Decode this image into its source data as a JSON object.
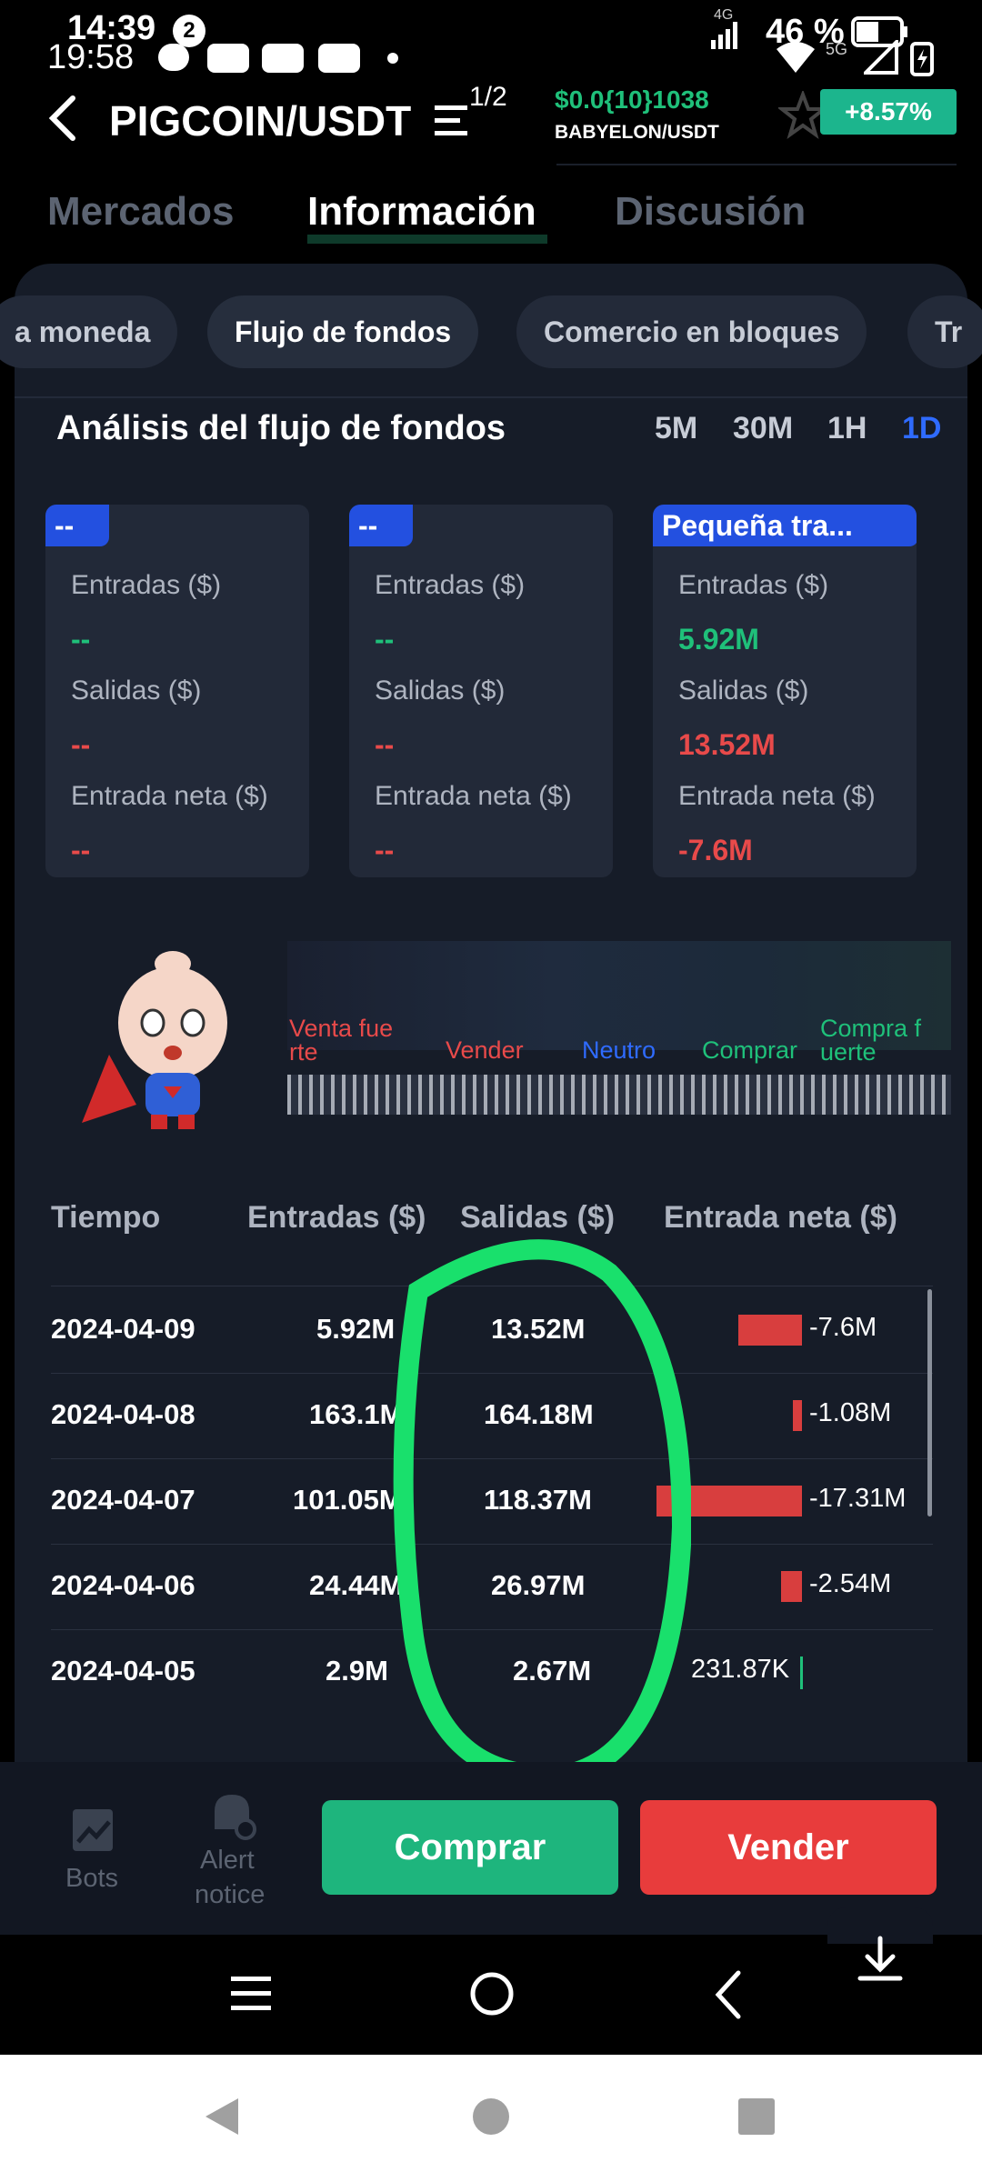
{
  "status": {
    "time_top": "14:39",
    "notif_count": "2",
    "time_bottom": "19:58",
    "battery": "46 %",
    "net_small": "4G",
    "net_5g": "5G",
    "page_indicator": "1/2"
  },
  "header": {
    "pair": "PIGCOIN/USDT",
    "ticker_price": "$0.0{10}1038",
    "ticker_pair": "BABYELON/USDT",
    "change": "+8.57%"
  },
  "tabs": [
    "Mercados",
    "Información",
    "Discusión"
  ],
  "chips": [
    "a moneda",
    "Flujo de fondos",
    "Comercio en bloques",
    "Tr"
  ],
  "analysis": {
    "title": "Análisis del flujo de fondos",
    "periods": [
      "5M",
      "30M",
      "1H",
      "1D"
    ]
  },
  "cards": [
    {
      "tag": "--",
      "in_label": "Entradas ($)",
      "in": "--",
      "out_label": "Salidas ($)",
      "out": "--",
      "net_label": "Entrada neta ($)",
      "net": "--"
    },
    {
      "tag": "--",
      "in_label": "Entradas ($)",
      "in": "--",
      "out_label": "Salidas ($)",
      "out": "--",
      "net_label": "Entrada neta ($)",
      "net": "--"
    },
    {
      "tag": "Pequeña tra...",
      "in_label": "Entradas ($)",
      "in": "5.92M",
      "out_label": "Salidas ($)",
      "out": "13.52M",
      "net_label": "Entrada neta ($)",
      "net": "-7.6M"
    }
  ],
  "gauge": {
    "l1": "Venta fue",
    "l2": "rte",
    "sell": "Vender",
    "neutral": "Neutro",
    "buy": "Comprar",
    "r1": "Compra f",
    "r2": "uerte"
  },
  "table": {
    "headers": [
      "Tiempo",
      "Entradas ($)",
      "Salidas ($)",
      "Entrada neta ($)"
    ],
    "rows": [
      {
        "date": "2024-04-09",
        "in": "5.92M",
        "out": "13.52M",
        "net": "-7.6M",
        "neg": true,
        "net_value": -7.6
      },
      {
        "date": "2024-04-08",
        "in": "163.1M",
        "out": "164.18M",
        "net": "-1.08M",
        "neg": true,
        "net_value": -1.08
      },
      {
        "date": "2024-04-07",
        "in": "101.05M",
        "out": "118.37M",
        "net": "-17.31M",
        "neg": true,
        "net_value": -17.31
      },
      {
        "date": "2024-04-06",
        "in": "24.44M",
        "out": "26.97M",
        "net": "-2.54M",
        "neg": true,
        "net_value": -2.54
      },
      {
        "date": "2024-04-05",
        "in": "2.9M",
        "out": "2.67M",
        "net": "231.87K",
        "neg": false,
        "net_value": 0.23
      }
    ]
  },
  "actions": {
    "bots": "Bots",
    "alert1": "Alert",
    "alert2": "notice",
    "buy": "Comprar",
    "sell": "Vender"
  },
  "colors": {
    "green": "#1fc07a",
    "red": "#e84a4a",
    "accent_blue": "#2f6bff",
    "highlight": "#19e06c"
  }
}
